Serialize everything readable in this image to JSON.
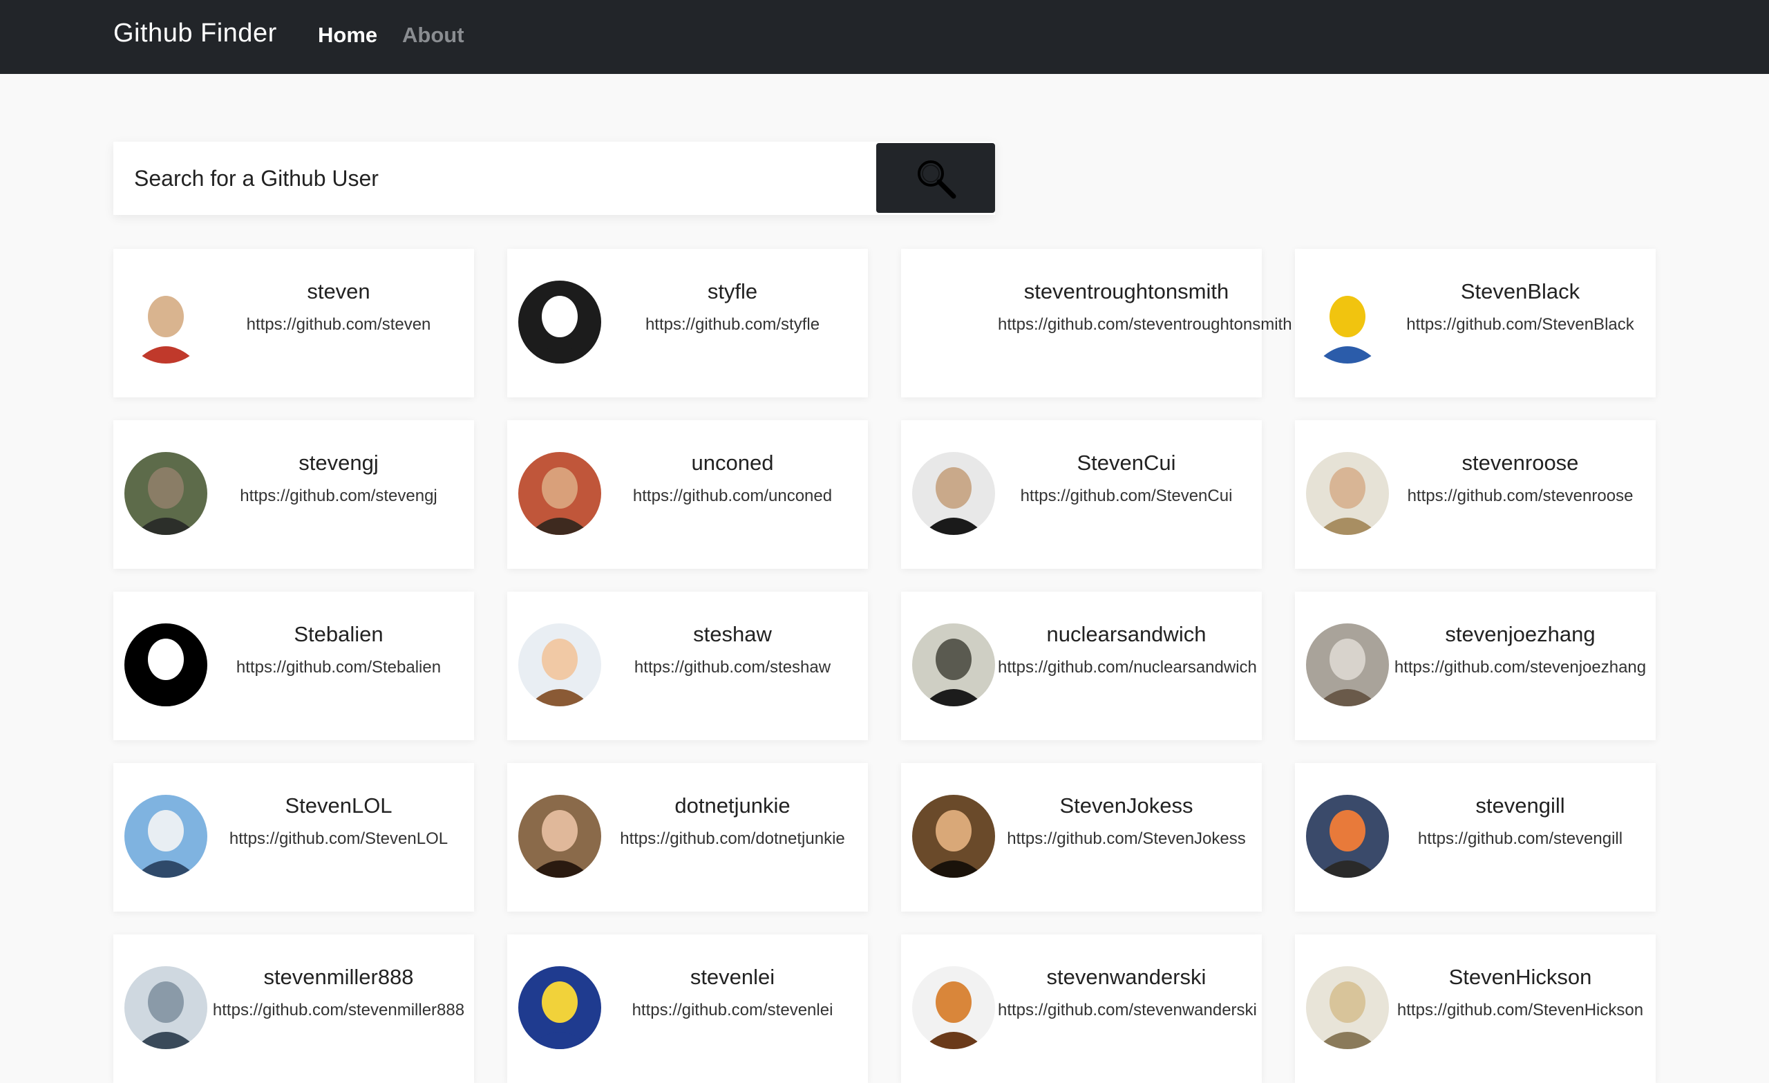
{
  "navbar": {
    "brand": "Github Finder",
    "links": [
      {
        "label": "Home",
        "active": true
      },
      {
        "label": "About",
        "active": false
      }
    ]
  },
  "search": {
    "placeholder": "Search for a Github User",
    "button_icon": "magnifier-icon"
  },
  "users": [
    {
      "login": "steven",
      "url": "https://github.com/steven",
      "avatar_colors": [
        "#ffffff",
        "#d9b48f",
        "#c0392b"
      ]
    },
    {
      "login": "styfle",
      "url": "https://github.com/styfle",
      "avatar_colors": [
        "#1c1c1c",
        "#ffffff",
        "#1c1c1c"
      ]
    },
    {
      "login": "steventroughtonsmith",
      "url": "https://github.com/steventroughtonsmith",
      "avatar_colors": null
    },
    {
      "login": "StevenBlack",
      "url": "https://github.com/StevenBlack",
      "avatar_colors": [
        "#ffffff",
        "#f1c40f",
        "#2b5caa"
      ]
    },
    {
      "login": "stevengj",
      "url": "https://github.com/stevengj",
      "avatar_colors": [
        "#5d6b4a",
        "#8a7d66",
        "#2c2f2a"
      ]
    },
    {
      "login": "unconed",
      "url": "https://github.com/unconed",
      "avatar_colors": [
        "#c0563a",
        "#d9a07a",
        "#3e2a1f"
      ]
    },
    {
      "login": "StevenCui",
      "url": "https://github.com/StevenCui",
      "avatar_colors": [
        "#e8e8e8",
        "#c9a98a",
        "#1a1a1a"
      ]
    },
    {
      "login": "stevenroose",
      "url": "https://github.com/stevenroose",
      "avatar_colors": [
        "#e6e2d6",
        "#d8b595",
        "#a88e62"
      ]
    },
    {
      "login": "Stebalien",
      "url": "https://github.com/Stebalien",
      "avatar_colors": [
        "#000000",
        "#ffffff",
        "#000000"
      ]
    },
    {
      "login": "steshaw",
      "url": "https://github.com/steshaw",
      "avatar_colors": [
        "#e9eef3",
        "#f1c9a5",
        "#8a5a35"
      ]
    },
    {
      "login": "nuclearsandwich",
      "url": "https://github.com/nuclearsandwich",
      "avatar_colors": [
        "#cfcfc4",
        "#5a5a50",
        "#1c1c1c"
      ]
    },
    {
      "login": "stevenjoezhang",
      "url": "https://github.com/stevenjoezhang",
      "avatar_colors": [
        "#a9a39a",
        "#d8d3cc",
        "#6a5a4a"
      ]
    },
    {
      "login": "StevenLOL",
      "url": "https://github.com/StevenLOL",
      "avatar_colors": [
        "#7fb3e0",
        "#e8eef3",
        "#2f4a6a"
      ]
    },
    {
      "login": "dotnetjunkie",
      "url": "https://github.com/dotnetjunkie",
      "avatar_colors": [
        "#8a6a4a",
        "#e0b89a",
        "#2a1a10"
      ]
    },
    {
      "login": "StevenJokess",
      "url": "https://github.com/StevenJokess",
      "avatar_colors": [
        "#6a4a2a",
        "#d9a878",
        "#1a120a"
      ]
    },
    {
      "login": "stevengill",
      "url": "https://github.com/stevengill",
      "avatar_colors": [
        "#3a4a6a",
        "#e87a3a",
        "#2a2a2a"
      ]
    },
    {
      "login": "stevenmiller888",
      "url": "https://github.com/stevenmiller888",
      "avatar_colors": [
        "#cfd8e0",
        "#8a9aa8",
        "#3a4a5a"
      ]
    },
    {
      "login": "stevenlei",
      "url": "https://github.com/stevenlei",
      "avatar_colors": [
        "#1f3b8f",
        "#f1d23a",
        "#1f3b8f"
      ]
    },
    {
      "login": "stevenwanderski",
      "url": "https://github.com/stevenwanderski",
      "avatar_colors": [
        "#f2f2f2",
        "#d9863a",
        "#6a3a1a"
      ]
    },
    {
      "login": "StevenHickson",
      "url": "https://github.com/StevenHickson",
      "avatar_colors": [
        "#e8e4d8",
        "#d8c49a",
        "#8a7a5a"
      ]
    }
  ]
}
